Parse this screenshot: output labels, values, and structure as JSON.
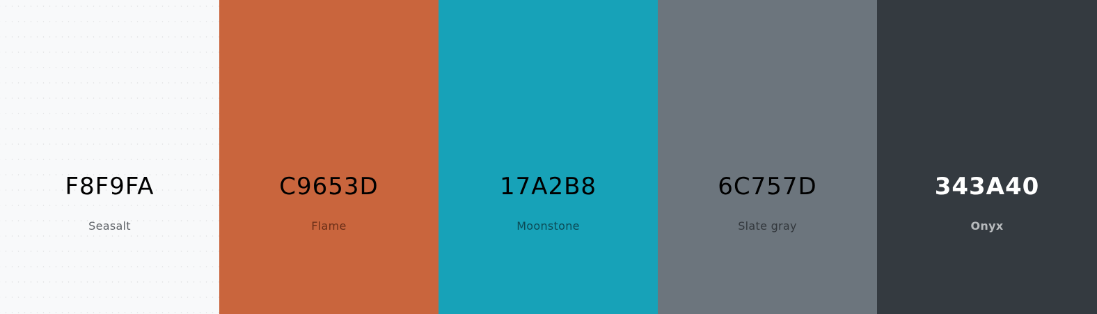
{
  "palette": {
    "swatches": [
      {
        "hex": "F8F9FA",
        "name": "Seasalt",
        "color": "#F8F9FA"
      },
      {
        "hex": "C9653D",
        "name": "Flame",
        "color": "#C9653D"
      },
      {
        "hex": "17A2B8",
        "name": "Moonstone",
        "color": "#17A2B8"
      },
      {
        "hex": "6C757D",
        "name": "Slate gray",
        "color": "#6C757D"
      },
      {
        "hex": "343A40",
        "name": "Onyx",
        "color": "#343A40"
      }
    ]
  }
}
